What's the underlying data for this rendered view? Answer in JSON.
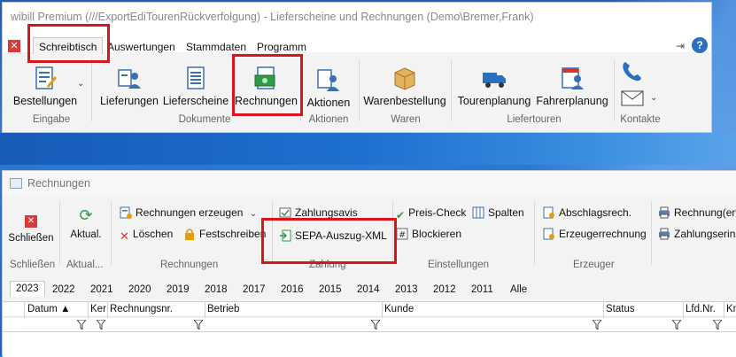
{
  "window1": {
    "title": "wibill Premium (///ExportEdiTourenRückverfolgung) - Lieferscheine und Rechnungen (Demo\\Bremer,Frank)",
    "menu": [
      "Schreibtisch",
      "Auswertungen",
      "Stammdaten",
      "Programm"
    ],
    "active_menu": "Schreibtisch",
    "help": "?",
    "ribbon": {
      "bestellungen": "Bestellungen",
      "lieferungen": "Lieferungen",
      "lieferscheine": "Lieferscheine",
      "rechnungen": "Rechnungen",
      "aktionen": "Aktionen",
      "warenbestellung": "Warenbestellung",
      "tourenplanung": "Tourenplanung",
      "fahrerplanung": "Fahrerplanung"
    },
    "groups": {
      "eingabe": "Eingabe",
      "dokumente": "Dokumente",
      "aktionen": "Aktionen",
      "waren": "Waren",
      "liefertouren": "Liefertouren",
      "kontakte": "Kontakte"
    }
  },
  "window2": {
    "title": "Rechnungen",
    "ribbon": {
      "schliessen": "Schließen",
      "aktual": "Aktual.",
      "rechnungen_erzeugen": "Rechnungen erzeugen",
      "loeschen": "Löschen",
      "festschreiben": "Festschreiben",
      "zahlungsavis": "Zahlungsavis",
      "sepa": "SEPA-Auszug-XML",
      "preis_check": "Preis-Check",
      "spalten": "Spalten",
      "blockieren": "Blockieren",
      "abschlagsrech": "Abschlagsrech.",
      "erzeugerrechnung": "Erzeugerrechnung",
      "rechnung_en": "Rechnung(en",
      "zahlungserin": "Zahlungserin"
    },
    "groups": {
      "schliessen": "Schließen",
      "aktual": "Aktual...",
      "rechnungen": "Rechnungen",
      "zahlung": "Zahlung",
      "einstellungen": "Einstellungen",
      "erzeuger": "Erzeuger"
    },
    "year_tabs": [
      "2023",
      "2022",
      "2021",
      "2020",
      "2019",
      "2018",
      "2017",
      "2016",
      "2015",
      "2014",
      "2013",
      "2012",
      "2011",
      "Alle"
    ],
    "active_year": "2023",
    "columns": {
      "datum": "Datum ▲",
      "ker": "Ker",
      "rechnungsnr": "Rechnungsnr.",
      "betrieb": "Betrieb",
      "kunde": "Kunde",
      "status": "Status",
      "lfdnr": "Lfd.Nr.",
      "kn": "Kn"
    }
  },
  "colors": {
    "highlight_box": "#d8141c",
    "accent_blue": "#2a6fc0",
    "desktop": "#1e5fb8"
  }
}
